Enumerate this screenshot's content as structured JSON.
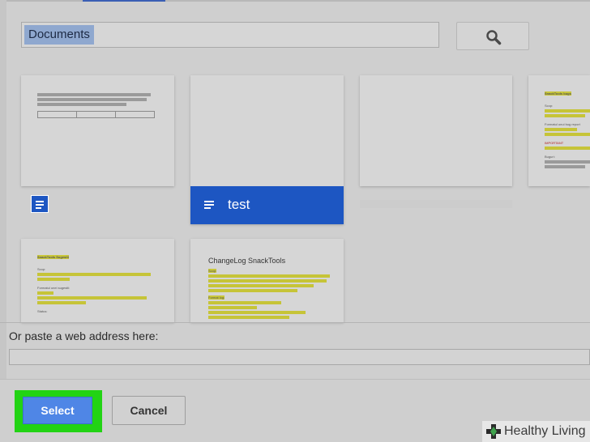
{
  "search": {
    "query": "Documents",
    "button_icon": "search-icon"
  },
  "docs": [
    {
      "title": ""
    },
    {
      "title": "test"
    },
    {
      "title": ""
    },
    {
      "heading": "SnackTools bugs",
      "lines": [
        "Scop:",
        "Formatul unui bug report",
        "IMPORTANT",
        "Bugurí:"
      ]
    },
    {
      "heading": "SnackTools Sugestii",
      "lines": [
        "Scop:",
        "Formatul unei sugestii:",
        "Status:"
      ]
    },
    {
      "heading": "ChangeLog SnackTools",
      "lines": [
        "Scop:",
        "Format log:"
      ]
    }
  ],
  "paste": {
    "label": "Or paste a web address here:",
    "value": ""
  },
  "buttons": {
    "select": "Select",
    "cancel": "Cancel"
  },
  "watermark": {
    "text": "Healthy Living",
    "icon": "plus-icon"
  },
  "colors": {
    "select_button": "#4f86e6",
    "highlight_frame": "#22d314",
    "selected_card": "#1d56c2"
  }
}
